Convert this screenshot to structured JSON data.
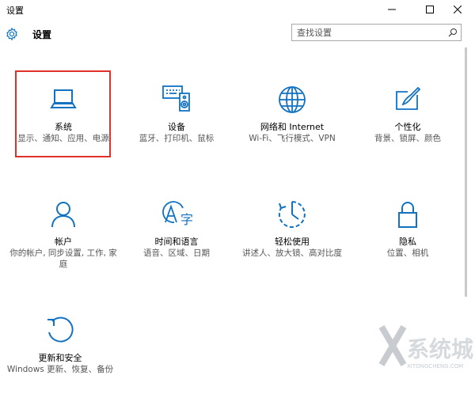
{
  "window": {
    "title": "设置"
  },
  "header": {
    "title": "设置"
  },
  "search": {
    "placeholder": "查找设置"
  },
  "accent": "#1172c2",
  "tiles": [
    {
      "label": "系统",
      "desc": "显示、通知、应用、电源",
      "icon": "laptop-icon"
    },
    {
      "label": "设备",
      "desc": "蓝牙、打印机、鼠标",
      "icon": "devices-icon"
    },
    {
      "label": "网络和 Internet",
      "desc": "Wi-Fi、飞行模式、VPN",
      "icon": "globe-icon"
    },
    {
      "label": "个性化",
      "desc": "背景、锁屏、颜色",
      "icon": "personalization-icon"
    },
    {
      "label": "帐户",
      "desc": "你的帐户, 同步设置, 工作, 家庭",
      "icon": "person-icon"
    },
    {
      "label": "时间和语言",
      "desc": "语音、区域、日期",
      "icon": "time-language-icon"
    },
    {
      "label": "轻松使用",
      "desc": "讲述人、放大镜、高对比度",
      "icon": "ease-of-access-icon"
    },
    {
      "label": "隐私",
      "desc": "位置、相机",
      "icon": "lock-icon"
    },
    {
      "label": "更新和安全",
      "desc": "Windows 更新、恢复、备份",
      "icon": "update-icon"
    }
  ],
  "watermark": {
    "text": "系统城",
    "subtext": "XITONGCHENG.COM"
  }
}
